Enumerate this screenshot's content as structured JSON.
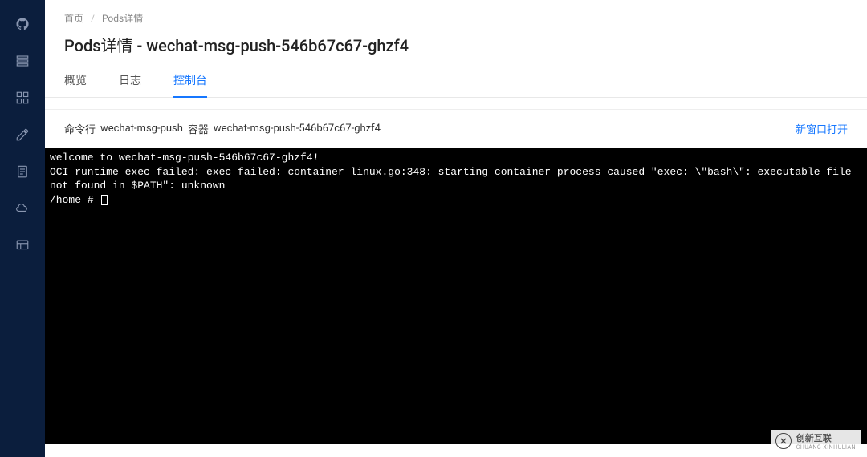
{
  "breadcrumb": {
    "home": "首页",
    "current": "Pods详情"
  },
  "page_title": "Pods详情 - wechat-msg-push-546b67c67-ghzf4",
  "tabs": [
    {
      "label": "概览",
      "active": false
    },
    {
      "label": "日志",
      "active": false
    },
    {
      "label": "控制台",
      "active": true
    }
  ],
  "panel": {
    "cmd_label": "命令行",
    "container_name": "wechat-msg-push",
    "container_word": "容器",
    "pod_name": "wechat-msg-push-546b67c67-ghzf4",
    "new_window": "新窗口打开"
  },
  "terminal": {
    "line1": "welcome to wechat-msg-push-546b67c67-ghzf4!",
    "line2": "OCI runtime exec failed: exec failed: container_linux.go:348: starting container process caused \"exec: \\\"bash\\\": executable file not found in $PATH\": unknown",
    "prompt": "/home # "
  },
  "watermark": {
    "zh": "创新互联",
    "en": "CHUANG XINHULIAN",
    "mark": "✕"
  },
  "sidebar_icons": [
    "github-icon",
    "list-icon",
    "grid-icon",
    "edit-icon",
    "doc-icon",
    "cloud-icon",
    "layout-icon"
  ]
}
